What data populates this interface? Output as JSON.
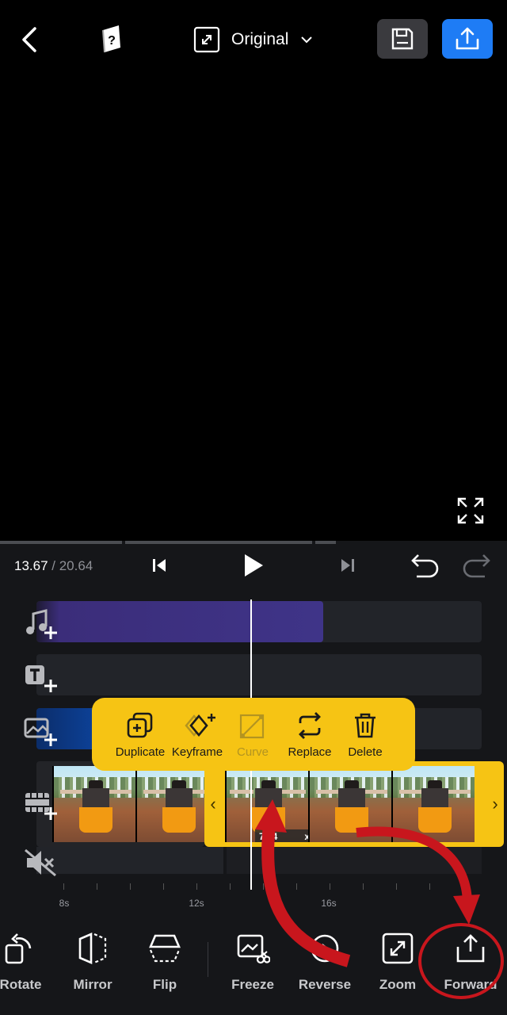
{
  "topbar": {
    "back_icon": "chevron-left-icon",
    "help_icon": "help-book-icon",
    "ratio_icon": "expand-arrows-icon",
    "ratio_label": "Original",
    "ratio_chevron_icon": "chevron-down-icon",
    "save_icon": "floppy-disk-icon",
    "export_icon": "upload-icon",
    "export_color": "#1e7cf5"
  },
  "preview": {
    "fullscreen_icon": "fullscreen-icon"
  },
  "playback": {
    "current_time": "13.67",
    "separator": " / ",
    "total_time": "20.64",
    "skip_start_icon": "skip-start-icon",
    "play_icon": "play-icon",
    "skip_end_icon": "skip-end-icon",
    "undo_icon": "undo-icon",
    "redo_icon": "redo-icon"
  },
  "tracks": {
    "music_icon": "add-music-icon",
    "text_icon": "add-text-icon",
    "sticker_icon": "add-sticker-icon",
    "video_icon": "add-video-icon",
    "mute_icon": "mute-icon",
    "audio_color": "#3f3488",
    "selected_clip_label": "7.74",
    "selected_clip_suffix": "x",
    "accent_color": "#f6c414"
  },
  "context_menu": {
    "items": [
      {
        "label": "Duplicate",
        "icon": "duplicate-icon",
        "enabled": true
      },
      {
        "label": "Keyframe",
        "icon": "keyframe-icon",
        "enabled": true
      },
      {
        "label": "Curve",
        "icon": "curve-icon",
        "enabled": false
      },
      {
        "label": "Replace",
        "icon": "replace-icon",
        "enabled": true
      },
      {
        "label": "Delete",
        "icon": "trash-icon",
        "enabled": true
      }
    ]
  },
  "ruler": {
    "labels": [
      "8s",
      "12s",
      "16s"
    ]
  },
  "toolbar": {
    "items": [
      {
        "label": "Rotate",
        "icon": "rotate-icon"
      },
      {
        "label": "Mirror",
        "icon": "mirror-icon"
      },
      {
        "label": "Flip",
        "icon": "flip-icon"
      },
      {
        "label": "Freeze",
        "icon": "freeze-icon"
      },
      {
        "label": "Reverse",
        "icon": "reverse-icon"
      },
      {
        "label": "Zoom",
        "icon": "zoom-icon"
      },
      {
        "label": "Forward",
        "icon": "forward-icon"
      }
    ]
  },
  "annotation": {
    "color": "#c8161d"
  }
}
